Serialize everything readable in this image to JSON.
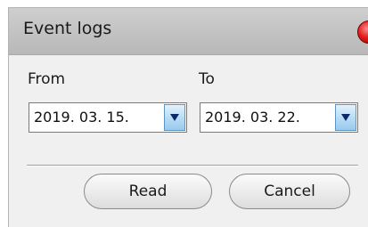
{
  "window": {
    "title": "Event logs"
  },
  "filters": {
    "from_label": "From",
    "from_value": "2019. 03. 15.",
    "to_label": "To",
    "to_value": "2019. 03. 22."
  },
  "actions": {
    "read_label": "Read",
    "cancel_label": "Cancel"
  },
  "colors": {
    "close_button": "#e02020",
    "dropdown_accent": "#98cbef",
    "dialog_background": "#f0f0f0"
  }
}
